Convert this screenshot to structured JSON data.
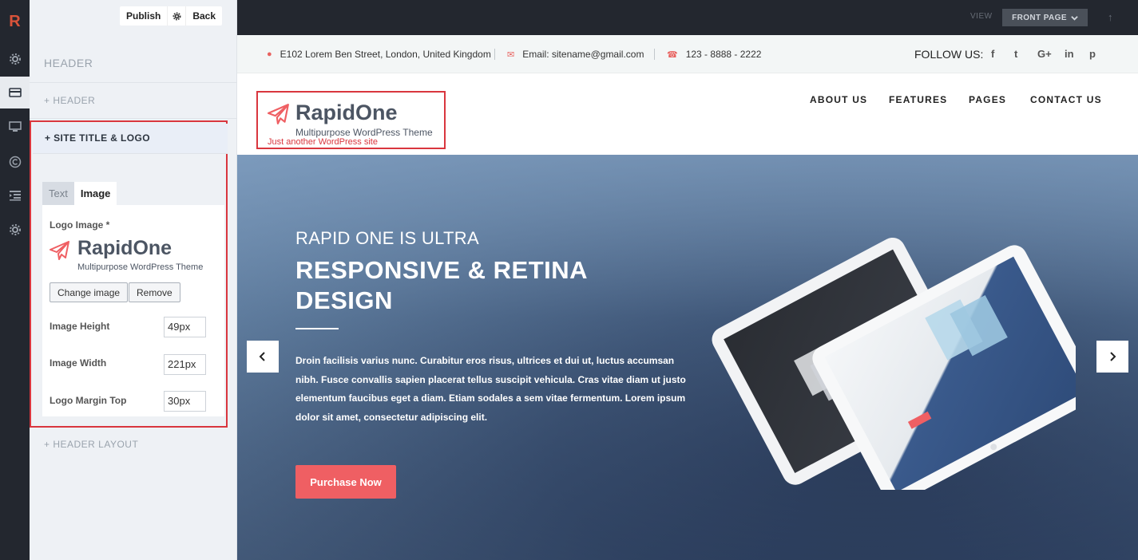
{
  "rail": {
    "logo": "R"
  },
  "panel": {
    "publish": "Publish",
    "back": "Back",
    "title": "HEADER",
    "sections": {
      "header": "+ HEADER",
      "site_title_logo": "+ SITE TITLE & LOGO",
      "header_layout": "+ HEADER LAYOUT"
    },
    "tabs": [
      "Text",
      "Image"
    ],
    "logo_label": "Logo Image *",
    "logo_preview": {
      "name": "RapidOne",
      "tagline": "Multipurpose WordPress Theme"
    },
    "change_image": "Change image",
    "remove": "Remove",
    "fields": [
      {
        "label": "Image Height",
        "value": "49px"
      },
      {
        "label": "Image Width",
        "value": "221px"
      },
      {
        "label": "Logo Margin Top",
        "value": "30px"
      }
    ]
  },
  "topbar": {
    "view": "VIEW",
    "front_page": "FRONT PAGE"
  },
  "infobar": {
    "address": "E102 Lorem Ben Street, London, United Kingdom",
    "email": "Email: sitename@gmail.com",
    "phone": "123 - 8888 - 2222",
    "follow": "FOLLOW US:",
    "socials": [
      "f",
      "t",
      "G+",
      "in",
      "p"
    ]
  },
  "nav": {
    "brand": "RapidOne",
    "tagline": "Multipurpose WordPress Theme",
    "site_desc": "Just another WordPress site",
    "links": [
      "ABOUT US",
      "FEATURES",
      "PAGES",
      "CONTACT US"
    ]
  },
  "hero": {
    "subtitle": "RAPID ONE IS ULTRA",
    "title": "RESPONSIVE & RETINA DESIGN",
    "description": "Droin facilisis varius nunc. Curabitur eros risus, ultrices et dui ut, luctus accumsan nibh. Fusce convallis sapien placerat tellus suscipit vehicula. Cras vitae diam ut justo elementum faucibus eget a diam. Etiam sodales a sem vitae fermentum. Lorem ipsum dolor sit amet, consectetur adipiscing elit.",
    "cta": "Purchase Now"
  },
  "colors": {
    "accent": "#ef5f63",
    "highlight_border": "#d9363e",
    "rail_bg": "#23272f"
  }
}
